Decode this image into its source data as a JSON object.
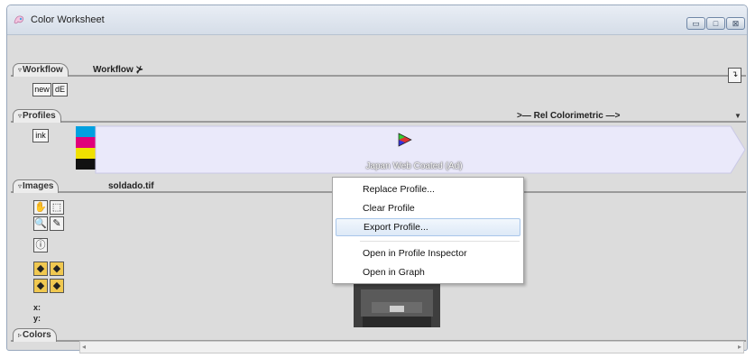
{
  "window": {
    "title": "Color Worksheet"
  },
  "workflow": {
    "tab_label": "Workflow",
    "header": "Workflow ⊁",
    "new_label": "new",
    "de_label": "dE"
  },
  "profiles": {
    "tab_label": "Profiles",
    "intent": ">— Rel Colorimetric —>",
    "ink_label": "ink",
    "profile_name": "Japan Web Coated (Ad)"
  },
  "images": {
    "tab_label": "Images",
    "file_name": "soldado.tif",
    "x_label": "x:",
    "y_label": "y:"
  },
  "colors": {
    "tab_label": "Colors"
  },
  "context_menu": {
    "items": [
      "Replace Profile...",
      "Clear Profile",
      "Export Profile...",
      "Open in Profile Inspector",
      "Open in Graph"
    ]
  },
  "colors_hex": {
    "cyan": "#00a0e0",
    "magenta": "#e0007a",
    "yellow": "#f0e000",
    "black": "#111111",
    "flow_bg": "#eae9fa"
  },
  "icons": {
    "app": "paint-icon",
    "workflow_action": "go-arrow-icon",
    "profile": "color-triangle-icon",
    "tools": [
      "hand-icon",
      "marquee-icon",
      "zoom-icon",
      "eyedropper-icon",
      "info-icon",
      "render-icon",
      "render-icon",
      "render-icon",
      "render-icon"
    ]
  }
}
